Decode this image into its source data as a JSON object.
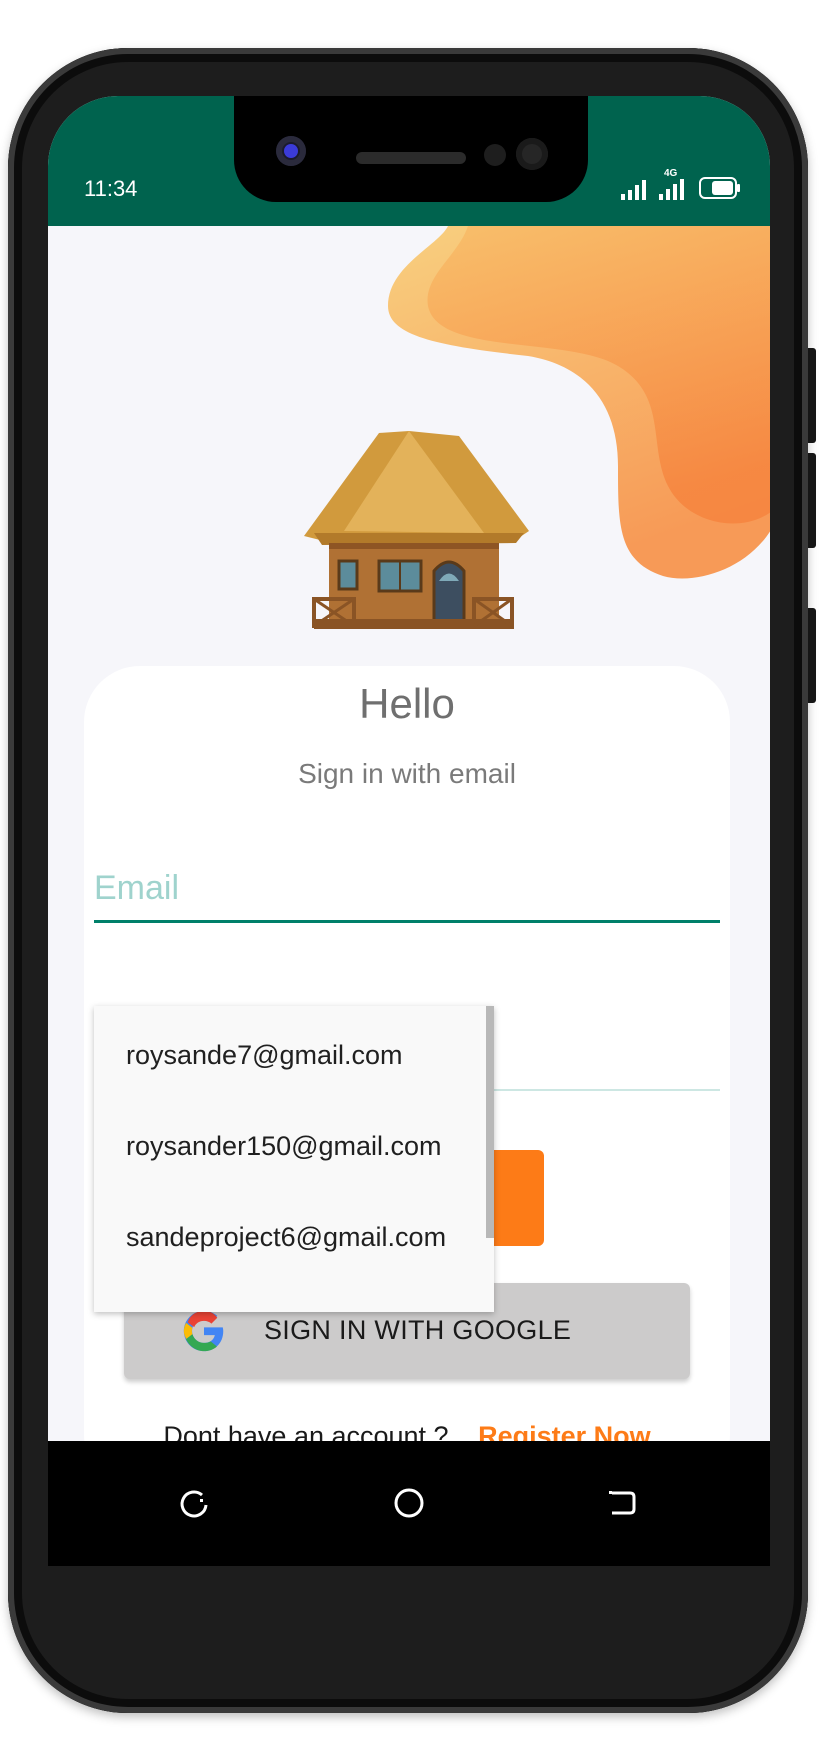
{
  "status_bar": {
    "time": "11:34",
    "network_label": "4G",
    "background_color": "#00634e"
  },
  "hero": {
    "image_description_icon": "thatched-hut-illustration",
    "accent_color": "#fd7b17"
  },
  "card": {
    "title": "Hello",
    "subtitle": "Sign in with email",
    "email_placeholder": "Email",
    "email_value": ""
  },
  "autocomplete": {
    "suggestions": [
      "roysande7@gmail.com",
      "roysander150@gmail.com",
      "sandeproject6@gmail.com"
    ]
  },
  "google_button": {
    "label": "SIGN IN WITH GOOGLE",
    "icon": "google-g-icon"
  },
  "register": {
    "prompt": "Dont have an account ?",
    "link": "Register Now"
  },
  "nav_bar": {
    "icons": [
      "recent-apps-icon",
      "home-icon",
      "back-icon"
    ]
  }
}
